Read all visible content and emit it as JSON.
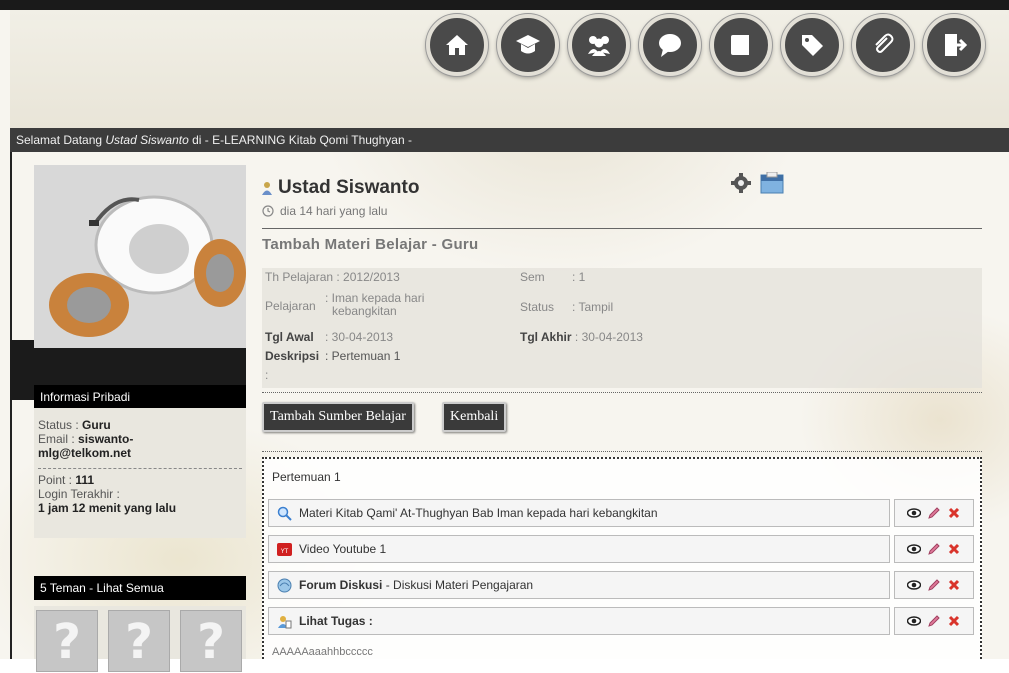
{
  "nav": {
    "items": [
      {
        "icon": "home-icon"
      },
      {
        "icon": "graduate-icon"
      },
      {
        "icon": "users-icon"
      },
      {
        "icon": "chat-bubble-icon"
      },
      {
        "icon": "book-icon"
      },
      {
        "icon": "tag-icon"
      },
      {
        "icon": "paperclip-icon"
      },
      {
        "icon": "logout-icon"
      }
    ]
  },
  "welcome": {
    "prefix": "Selamat Datang ",
    "user": "Ustad Siswanto",
    "suffix": " di - E-LEARNING Kitab Qomi Thughyan -"
  },
  "profile": {
    "name": "Ustad Siswanto",
    "last_seen": "dia 14 hari yang lalu"
  },
  "section_title": "Tambah Materi Belajar - Guru",
  "details": {
    "th_pelajaran_label": "Th Pelajaran",
    "th_pelajaran_value": ": 2012/2013",
    "sem_label": "Sem",
    "sem_value": ": 1",
    "pelajaran_label": "Pelajaran",
    "pelajaran_value_1": ": Iman kepada hari",
    "pelajaran_value_2": "kebangkitan",
    "status_label": "Status",
    "status_value": ": Tampil",
    "tgl_awal_label": "Tgl Awal",
    "tgl_awal_value": ": 30-04-2013",
    "tgl_akhir_label": "Tgl Akhir",
    "tgl_akhir_value": ": 30-04-2013",
    "deskripsi_label": "Deskripsi",
    "deskripsi_value": ": Pertemuan 1",
    "extra_colon": ":"
  },
  "buttons": {
    "tambah": "Tambah Sumber Belajar",
    "kembali": "Kembali"
  },
  "content": {
    "heading": "Pertemuan 1",
    "items": [
      {
        "icon": "search-icon",
        "bold": "",
        "text": "Materi Kitab Qami' At-Thughyan Bab Iman kepada hari kebangkitan"
      },
      {
        "icon": "youtube-icon",
        "bold": "",
        "text": "Video Youtube 1"
      },
      {
        "icon": "forum-icon",
        "bold": "Forum Diskusi",
        "text": " - Diskusi Materi Pengajaran"
      },
      {
        "icon": "assignment-icon",
        "bold": "Lihat Tugas :",
        "text": ""
      }
    ],
    "tugas_sub": "AAAAAaaahhbccccc"
  },
  "sidebar": {
    "info_title": "Informasi Pribadi",
    "status_label": "Status : ",
    "status_value": "Guru",
    "email_label": "Email : ",
    "email_value_1": "siswanto-",
    "email_value_2": "mlg@telkom.net",
    "point_label": "Point : ",
    "point_value": "111",
    "login_label": "Login Terakhir :",
    "login_value": "1 jam 12 menit yang lalu",
    "friends_title": "5 Teman - Lihat Semua",
    "friend_placeholder": "?"
  },
  "colors": {
    "header_bar": "#3c3c3c",
    "nav_button": "#4a4a4a",
    "side_title": "#000000",
    "delete_red": "#d9342b"
  }
}
